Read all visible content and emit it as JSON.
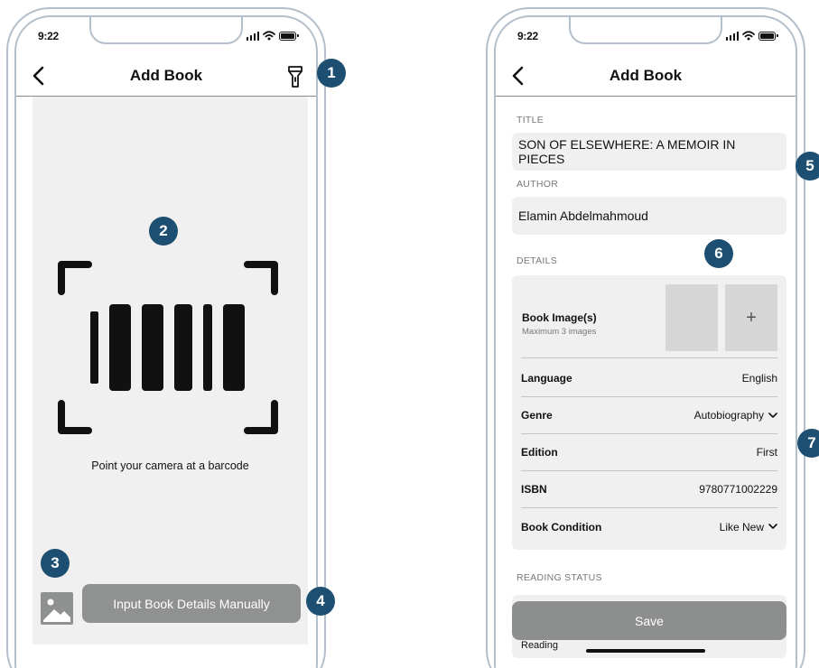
{
  "left_screen": {
    "status_time": "9:22",
    "nav_title": "Add Book",
    "scan_hint": "Point your camera at a barcode",
    "manual_button_label": "Input Book Details Manually",
    "icons": [
      "back-chevron-icon",
      "flashlight-icon",
      "barcode-icon",
      "image-gallery-icon"
    ]
  },
  "right_screen": {
    "status_time": "9:22",
    "nav_title": "Add Book",
    "title_label": "TITLE",
    "title_value": "SON OF ELSEWHERE: A MEMOIR IN PIECES",
    "author_label": "AUTHOR",
    "author_value": "Elamin Abdelmahmoud",
    "details_label": "DETAILS",
    "book_image_label": "Book Image(s)",
    "book_image_sub": "Maximum 3 images",
    "add_image_symbol": "+",
    "details": [
      {
        "label": "Language",
        "value": "English",
        "dropdown": false
      },
      {
        "label": "Genre",
        "value": "Autobiography",
        "dropdown": true
      },
      {
        "label": "Edition",
        "value": "First",
        "dropdown": false
      },
      {
        "label": "ISBN",
        "value": "9780771002229",
        "dropdown": false
      },
      {
        "label": "Book Condition",
        "value": "Like New",
        "dropdown": true
      }
    ],
    "reading_status_label": "READING STATUS",
    "reading_status_value": "Reading",
    "save_label": "Save"
  },
  "annotations": [
    "1",
    "2",
    "3",
    "4",
    "5",
    "6",
    "7"
  ],
  "colors": {
    "badge": "#1d4f72",
    "button_gray": "#909291",
    "panel_gray": "#f0f0f0",
    "frame": "#b3bfca"
  }
}
